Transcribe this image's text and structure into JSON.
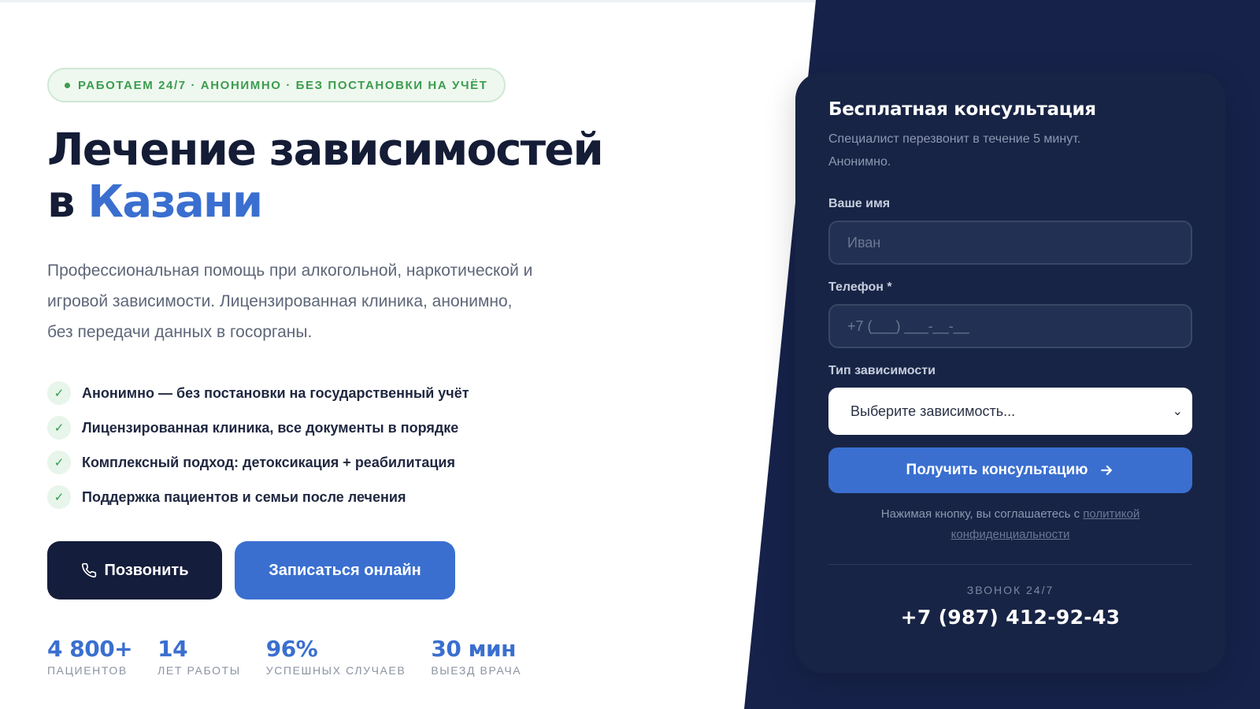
{
  "hero": {
    "badge": "РАБОТАЕМ 24/7 · АНОНИМНО · БЕЗ ПОСТАНОВКИ НА УЧЁТ",
    "title_line1": "Лечение зависимостей",
    "title_prefix": "в ",
    "title_accent": "Казани",
    "lead": "Профессиональная помощь при алкогольной, наркотической и игровой зависимости. Лицензированная клиника, анонимно, без передачи данных в госорганы.",
    "features": [
      "Анонимно — без постановки на государственный учёт",
      "Лицензированная клиника, все документы в порядке",
      "Комплексный подход: детоксикация + реабилитация",
      "Поддержка пациентов и семьи после лечения"
    ],
    "call_button": "Позвонить",
    "online_button": "Записаться онлайн",
    "stats": [
      {
        "value": "4 800+",
        "label": "ПАЦИЕНТОВ"
      },
      {
        "value": "14",
        "label": "ЛЕТ РАБОТЫ"
      },
      {
        "value": "96%",
        "label": "УСПЕШНЫХ СЛУЧАЕВ"
      },
      {
        "value": "30 мин",
        "label": "ВЫЕЗД ВРАЧА"
      }
    ]
  },
  "form": {
    "title": "Бесплатная консультация",
    "subtitle": "Специалист перезвонит в течение 5 минут. Анонимно.",
    "name_label": "Ваше имя",
    "name_placeholder": "Иван",
    "phone_label": "Телефон *",
    "phone_placeholder": "+7 (___) ___-__-__",
    "type_label": "Тип зависимости",
    "type_selected": "Выберите зависимость...",
    "submit": "Получить консультацию",
    "terms_text": "Нажимая кнопку, вы соглашаетесь с ",
    "terms_link": "политикой конфиденциальности",
    "call_label": "ЗВОНОК 24/7",
    "phone_number": "+7 (987) 412-92-43"
  },
  "colors": {
    "accent": "#3a6fd0",
    "dark": "#16224a",
    "success": "#3c9c4e"
  },
  "icons": {
    "badge_dot": "dot-icon",
    "check": "check-icon",
    "phone": "phone-icon",
    "arrow": "arrow-right-icon",
    "chevron": "chevron-down-icon"
  }
}
